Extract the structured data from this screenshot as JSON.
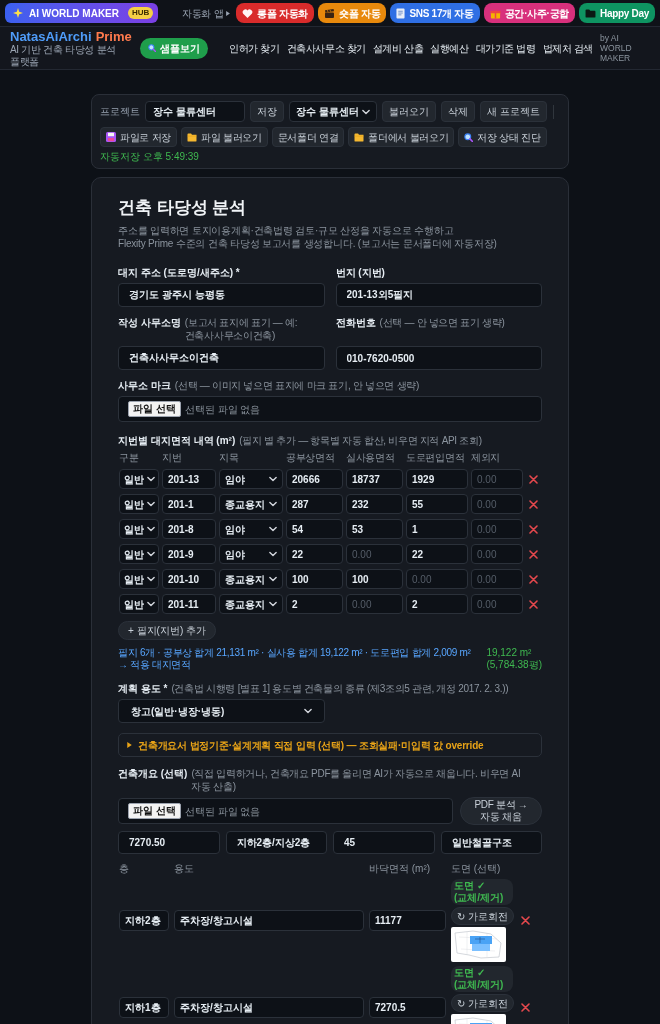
{
  "top_bar": {
    "hub_button": {
      "label": "AI WORLD MAKER",
      "badge": "HUB"
    },
    "apps_label": "자동화 앱",
    "app_buttons": [
      {
        "label": "롱폼 자동화",
        "color": "#d92b2b"
      },
      {
        "label": "숏폼 자동",
        "color": "#e8890c"
      },
      {
        "label": "SNS 17개 자동",
        "color": "#2f6fe4"
      },
      {
        "label": "공간·사주·궁합",
        "color": "#d8307c"
      },
      {
        "label": "Happy Day",
        "color": "#0e9461"
      }
    ]
  },
  "header": {
    "logo": {
      "name": "NatasAiArchi",
      "suffix": "Prime"
    },
    "tagline": "AI 기반 건축 타당성 분석 플랫폼",
    "sample_button": "샘플보기",
    "nav_links": [
      "인허가 찾기",
      "건축사사무소 찾기",
      "설계비 산출",
      "실행예산",
      "대가기준 법령",
      "법제처 검색"
    ],
    "byline": "by AI WORLD MAKER"
  },
  "project_panel": {
    "label": "프로젝트",
    "name_field": {
      "value": "장수 물류센터"
    },
    "save_button": "저장",
    "project_select": {
      "value": "장수 물류센터"
    },
    "buttons": [
      "불러오기",
      "삭제",
      "새 프로젝트"
    ],
    "file_buttons": [
      {
        "label": "파일로 저장",
        "kind": "save"
      },
      {
        "label": "파일 불러오기",
        "kind": "open"
      },
      {
        "label": "문서폴더 연결",
        "kind": "link"
      },
      {
        "label": "폴더에서 불러오기",
        "kind": "open"
      },
      {
        "label": "저장 상태 진단",
        "kind": "diagnose"
      }
    ],
    "autosave_status": "자동저장 오후 5:49:39"
  },
  "analysis": {
    "title": "건축 타당성 분석",
    "description": "주소를 입력하면 토지이용계획·건축법령 검토·규모 산정을 자동으로 수행하고\nFlexity Prime 수준의 건축 타당성 보고서를 생성합니다. (보고서는 문서폴더에 자동저장)",
    "fields": [
      {
        "label": "대지 주소 (도로명/새주소) *",
        "value": "경기도 광주시 능평동"
      },
      {
        "label": "번지 (지번)",
        "value": "201-13외5필지"
      },
      {
        "label": "작성 사무소명",
        "hint": "(보고서 표지에 표기 — 예: 건축사사무소이건축)",
        "value": "건축사사무소이건축"
      },
      {
        "label": "전화번호",
        "hint": "(선택 — 안 넣으면 표기 생략)",
        "value": "010-7620-0500"
      }
    ],
    "office_mark": {
      "label": "사무소 마크",
      "hint": "(선택 — 이미지 넣으면 표지에 마크 표기, 안 넣으면 생략)",
      "file_button": "파일 선택",
      "file_status": "선택된 파일 없음"
    },
    "parcels": {
      "label": "지번별 대지면적 내역 (m²)",
      "hint": "(필지 별 추가 — 항목별 자동 합산, 비우면 지적 API 조회)",
      "columns": [
        "구분",
        "지번",
        "지목",
        "공부상면적",
        "실사용면적",
        "도로편입면적",
        "제외지"
      ],
      "rows": [
        {
          "type": "일반",
          "lot": "201-13",
          "category": "임야",
          "areas": [
            {
              "value": "20666"
            },
            {
              "value": "18737"
            },
            {
              "value": "1929"
            },
            {
              "placeholder": "0.00"
            }
          ]
        },
        {
          "type": "일반",
          "lot": "201-1",
          "category": "종교용지",
          "areas": [
            {
              "value": "287"
            },
            {
              "value": "232"
            },
            {
              "value": "55"
            },
            {
              "placeholder": "0.00"
            }
          ]
        },
        {
          "type": "일반",
          "lot": "201-8",
          "category": "임야",
          "areas": [
            {
              "value": "54"
            },
            {
              "value": "53"
            },
            {
              "value": "1"
            },
            {
              "placeholder": "0.00"
            }
          ]
        },
        {
          "type": "일반",
          "lot": "201-9",
          "category": "임야",
          "areas": [
            {
              "value": "22"
            },
            {
              "placeholder": "0.00"
            },
            {
              "value": "22"
            },
            {
              "placeholder": "0.00"
            }
          ]
        },
        {
          "type": "일반",
          "lot": "201-10",
          "category": "종교용지",
          "areas": [
            {
              "value": "100"
            },
            {
              "value": "100"
            },
            {
              "placeholder": "0.00"
            },
            {
              "placeholder": "0.00"
            }
          ]
        },
        {
          "type": "일반",
          "lot": "201-11",
          "category": "종교용지",
          "areas": [
            {
              "value": "2"
            },
            {
              "placeholder": "0.00"
            },
            {
              "value": "2"
            },
            {
              "placeholder": "0.00"
            }
          ]
        }
      ],
      "add_button": "+ 필지(지번) 추가",
      "summary": "필지 6개 · 공부상 합계 21,131 m² · 실사용 합계 19,122 m² · 도로편입 합계 2,009 m²  →  적용 대지면적",
      "site_area": "19,122 m²",
      "site_area_pyeong": "(5,784.38평)"
    },
    "use": {
      "label": "계획 용도 *",
      "hint": "(건축법 시행령 [별표 1] 용도별 건축물의 종류 (제3조의5 관련, 개정 2017. 2. 3.))",
      "value": "창고(일반·냉장·냉동)"
    },
    "override_section": {
      "title": "건축개요서 법정기준·설계계획 직접 입력 (선택) — 조회실패·미입력 값 override",
      "expanded": false
    },
    "overview": {
      "label": "건축개요 (선택)",
      "hint": "(직접 입력하거나, 건축개요 PDF를 올리면 AI가 자동으로 채웁니다. 비우면 AI 자동 산출)",
      "file_button": "파일 선택",
      "file_status": "선택된 파일 없음",
      "pdf_button": "PDF 분석 → 자동 채움",
      "values": [
        "7270.50",
        "지하2층/지상2층",
        "45",
        "일반철골구조"
      ]
    },
    "floors": {
      "columns": [
        "층",
        "용도",
        "바닥면적 (m²)",
        "도면 (선택)"
      ],
      "rows": [
        {
          "floor": "지하2층",
          "use": "주차장/창고시설",
          "area": "11177",
          "plan_status": "도면 ✓ (교체/제거)",
          "rotate_button": "↻ 가로회전"
        },
        {
          "floor": "지하1층",
          "use": "주차장/창고시설",
          "area": "7270.5",
          "plan_status": "도면 ✓ (교체/제거)",
          "rotate_button": "↻ 가로회전"
        }
      ]
    }
  }
}
